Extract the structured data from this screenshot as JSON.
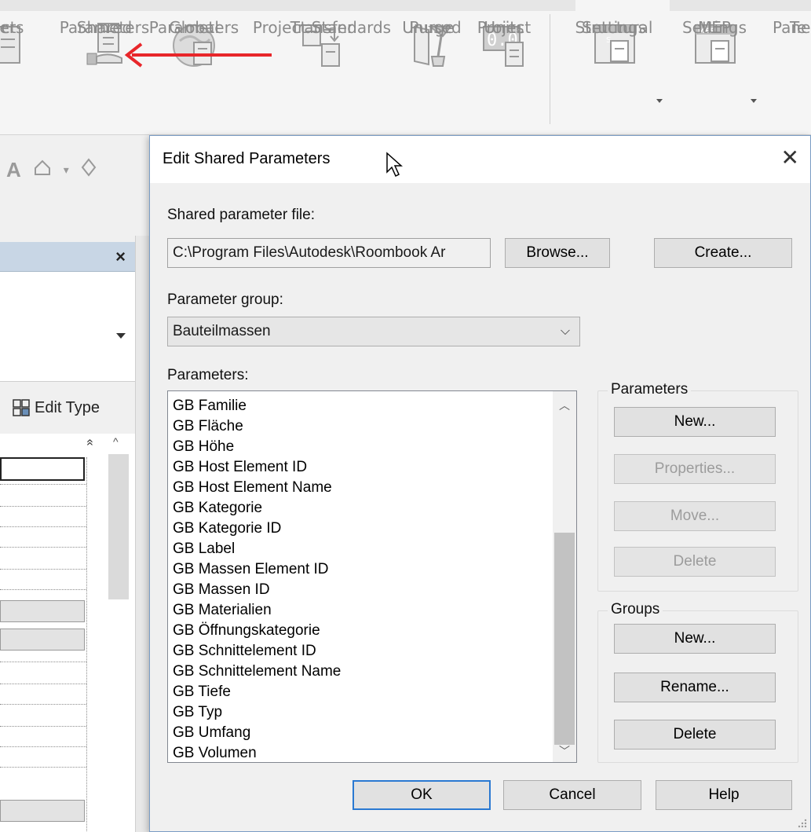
{
  "ribbon": {
    "buttons": [
      {
        "id": "project-parameters",
        "label1": "ct",
        "label2": "ters"
      },
      {
        "id": "shared-parameters",
        "label1": "Shared",
        "label2": "Parameters"
      },
      {
        "id": "global-parameters",
        "label1": "Global",
        "label2": "Parameters"
      },
      {
        "id": "transfer-project-standards",
        "label1": "Transfer",
        "label2": "Project Standards"
      },
      {
        "id": "purge-unused",
        "label1": "Purge",
        "label2": "Unused"
      },
      {
        "id": "project-units",
        "label1": "Project",
        "label2": "Units"
      },
      {
        "id": "structural-settings",
        "label1": "Structural",
        "label2": "Settings"
      },
      {
        "id": "mep-settings",
        "label1": "MEP",
        "label2": "Settings"
      },
      {
        "id": "panel-te",
        "label1": "Pane",
        "label2": "Te"
      }
    ],
    "mep_badge": "MEP",
    "units_badge": "0.0",
    "structural_badge": "S"
  },
  "left_panel": {
    "close": "×",
    "edit_type": "Edit Type",
    "collapse": "»",
    "scroll_up": "^"
  },
  "dialog": {
    "title": "Edit Shared Parameters",
    "close": "✕",
    "file_label": "Shared parameter file:",
    "file_value": "C:\\Program Files\\Autodesk\\Roombook Ar",
    "browse": "Browse...",
    "create": "Create...",
    "group_label": "Parameter group:",
    "group_value": "Bauteilmassen",
    "params_label": "Parameters:",
    "parameters": [
      "GB Familie",
      "GB Fläche",
      "GB Höhe",
      "GB Host Element ID",
      "GB Host Element Name",
      "GB Kategorie",
      "GB Kategorie ID",
      "GB Label",
      "GB Massen Element ID",
      "GB Massen ID",
      "GB Materialien",
      "GB Öffnungskategorie",
      "GB Schnittelement ID",
      "GB Schnittelement Name",
      "GB Tiefe",
      "GB Typ",
      "GB Umfang",
      "GB Volumen"
    ],
    "params_group": {
      "title": "Parameters",
      "new": "New...",
      "properties": "Properties...",
      "move": "Move...",
      "delete": "Delete"
    },
    "groups_group": {
      "title": "Groups",
      "new": "New...",
      "rename": "Rename...",
      "delete": "Delete"
    },
    "ok": "OK",
    "cancel": "Cancel",
    "help": "Help"
  },
  "colors": {
    "arrow": "#e8262a",
    "default_button_border": "#2a79d2",
    "panel_header": "#c8d6e5"
  }
}
